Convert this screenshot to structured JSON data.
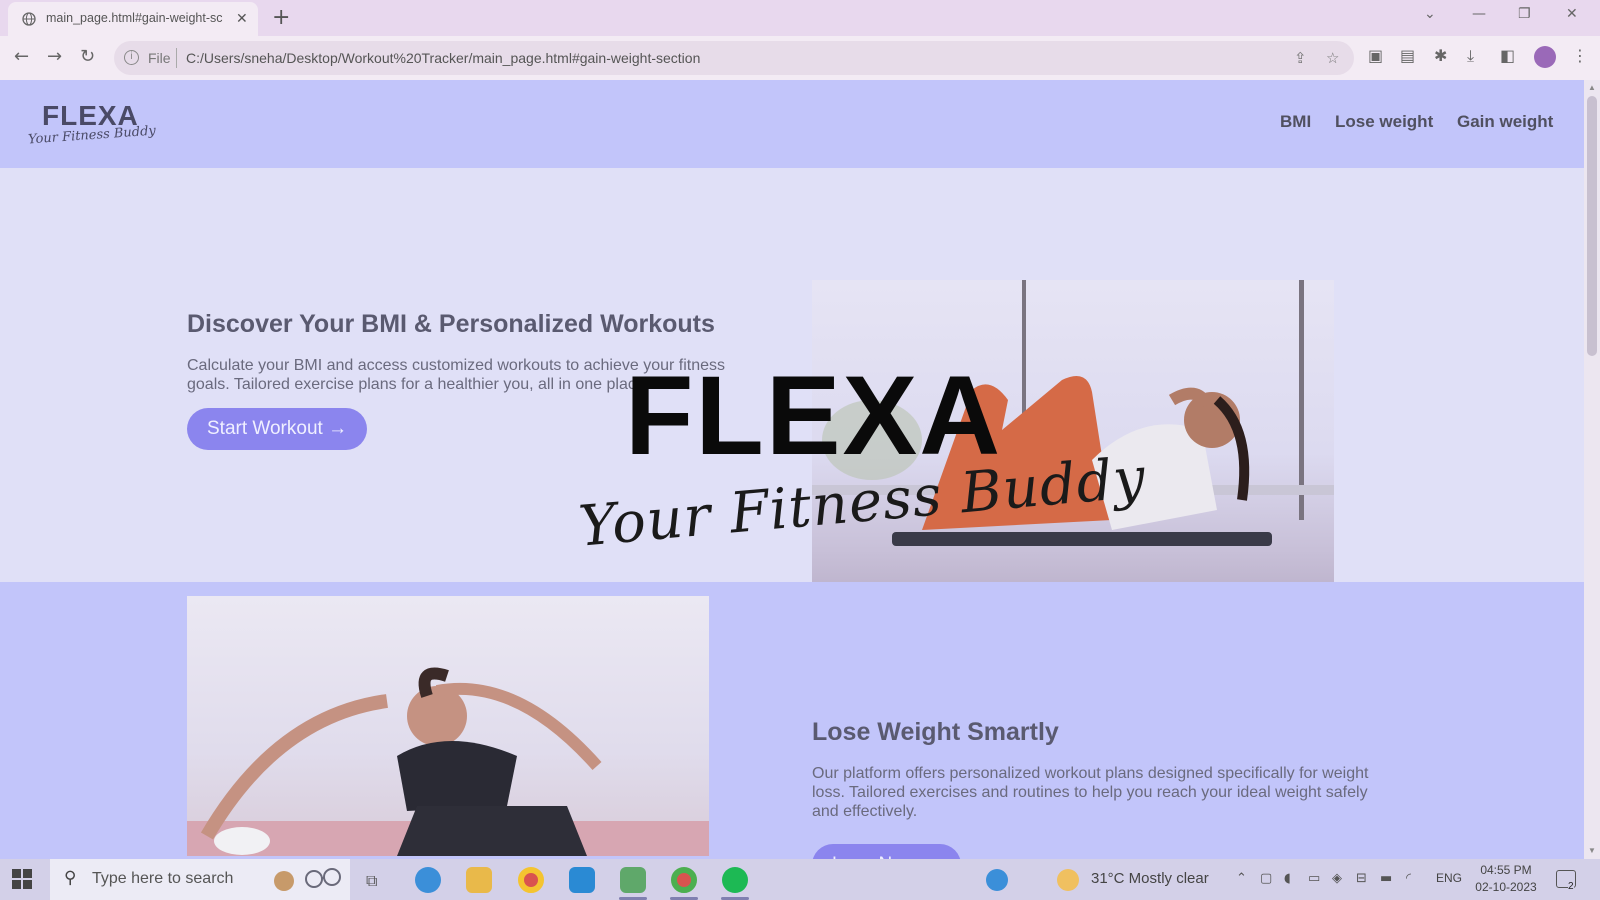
{
  "browser": {
    "tab_title": "main_page.html#gain-weight-sc",
    "new_tab_icon": "plus-icon",
    "address_scheme": "File",
    "address_url": "C:/Users/sneha/Desktop/Workout%20Tracker/main_page.html#gain-weight-section"
  },
  "site": {
    "logo_word": "FLEXA",
    "logo_tagline": "Your Fitness Buddy",
    "nav": [
      "BMI",
      "Lose weight",
      "Gain weight"
    ],
    "hero": {
      "title": "Discover Your BMI & Personalized Workouts",
      "text": "Calculate your BMI and access customized workouts to achieve your fitness goals. Tailored exercise plans for a healthier you, all in one place.",
      "button": "Start Workout →"
    },
    "lose_section": {
      "title": "Lose Weight Smartly",
      "text": "Our platform offers personalized workout plans designed specifically for weight loss. Tailored exercises and routines to help you reach your ideal weight safely and effectively.",
      "button": "Lose Now →"
    },
    "splash": {
      "word": "FLEXA",
      "tagline": "Your Fitness Buddy"
    }
  },
  "taskbar": {
    "search_placeholder": "Type here to search",
    "weather": "31°C  Mostly clear",
    "language": "ENG",
    "time": "04:55 PM",
    "date": "02-10-2023",
    "notification_count": "2"
  },
  "colors": {
    "header_bg": "#c2c5fa",
    "hero_bg": "#e0e0f7",
    "button": "#8b85ee",
    "tab_strip": "#e8d8ee"
  }
}
